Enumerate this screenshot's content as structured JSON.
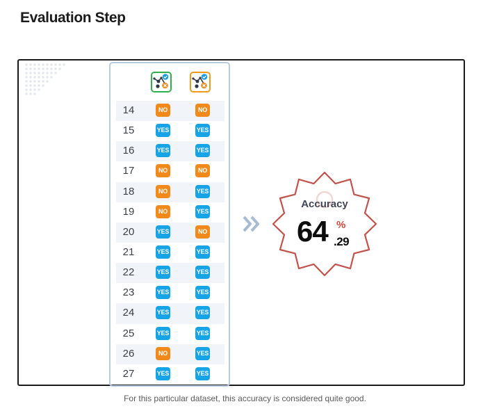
{
  "page": {
    "title": "Evaluation Step",
    "caption": "For this particular dataset, this accuracy is considered quite good."
  },
  "table": {
    "column_icons": [
      {
        "icon": "model-check-cross-icon",
        "border_color": "#2fb04d"
      },
      {
        "icon": "model-check-cross-icon",
        "border_color": "#f29a1b"
      }
    ],
    "rows": [
      {
        "id": "14",
        "col1": "NO",
        "col2": "NO"
      },
      {
        "id": "15",
        "col1": "YES",
        "col2": "YES"
      },
      {
        "id": "16",
        "col1": "YES",
        "col2": "YES"
      },
      {
        "id": "17",
        "col1": "NO",
        "col2": "NO"
      },
      {
        "id": "18",
        "col1": "NO",
        "col2": "YES"
      },
      {
        "id": "19",
        "col1": "NO",
        "col2": "YES"
      },
      {
        "id": "20",
        "col1": "YES",
        "col2": "NO"
      },
      {
        "id": "21",
        "col1": "YES",
        "col2": "YES"
      },
      {
        "id": "22",
        "col1": "YES",
        "col2": "YES"
      },
      {
        "id": "23",
        "col1": "YES",
        "col2": "YES"
      },
      {
        "id": "24",
        "col1": "YES",
        "col2": "YES"
      },
      {
        "id": "25",
        "col1": "YES",
        "col2": "YES"
      },
      {
        "id": "26",
        "col1": "NO",
        "col2": "YES"
      },
      {
        "id": "27",
        "col1": "YES",
        "col2": "YES"
      }
    ]
  },
  "accuracy": {
    "label": "Accuracy",
    "integer": "64",
    "percent_sign": "%",
    "decimal": ".29"
  },
  "colors": {
    "yes": "#16a4e6",
    "no": "#f28a1b",
    "star_outline": "#c2524c",
    "arrow": "#a9bbd3",
    "panel_border": "#b9cbe0"
  },
  "icons": {
    "flow_arrow": "double-chevron-right-icon",
    "badge_shape": "star-badge-icon"
  }
}
